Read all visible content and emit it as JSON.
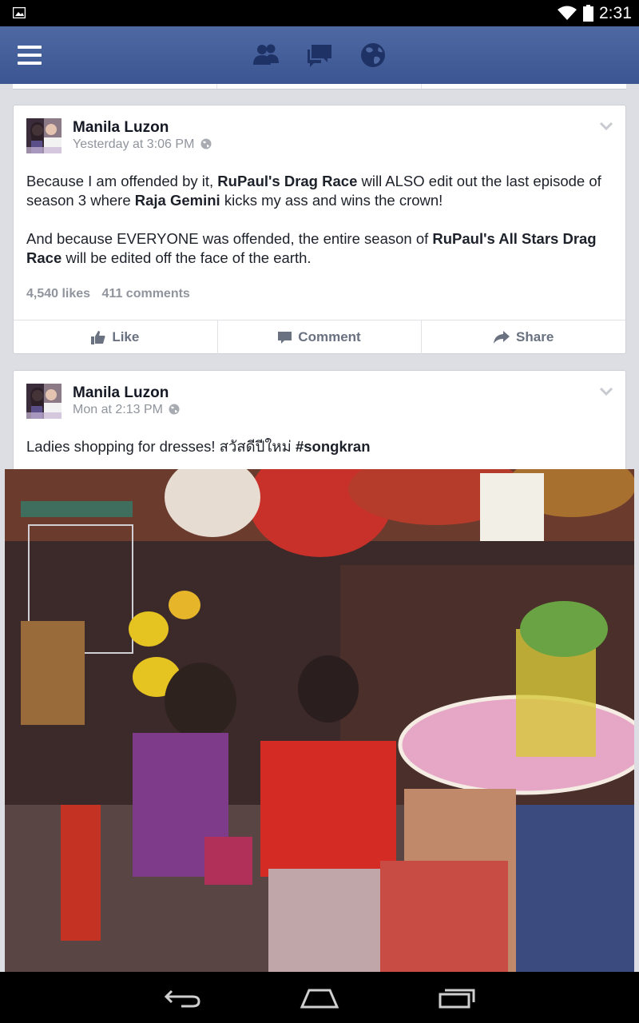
{
  "status_bar": {
    "time": "2:31"
  },
  "feed": {
    "posts": [
      {
        "author": "Manila Luzon",
        "timestamp": "Yesterday at 3:06 PM",
        "p1_pre": "Because I am offended by it, ",
        "p1_b1": "RuPaul's Drag Race",
        "p1_mid": " will ALSO edit out the last episode of season 3 where ",
        "p1_b2": "Raja Gemini",
        "p1_post": " kicks my ass and wins the crown!",
        "p2_pre": "And because EVERYONE was offended, the entire season of ",
        "p2_b1": "RuPaul's All Stars Drag Race",
        "p2_post": " will be edited off the face of the earth.",
        "likes": "4,540 likes",
        "comments": "411 comments",
        "actions": {
          "like": "Like",
          "comment": "Comment",
          "share": "Share"
        }
      },
      {
        "author": "Manila Luzon",
        "timestamp": "Mon at 2:13 PM",
        "text": "Ladies shopping for dresses! สวัสดีปีใหม่ ",
        "hashtag": "#songkran"
      }
    ]
  },
  "colors": {
    "fb_blue": "#3b5998",
    "text": "#141823",
    "meta": "#90949c"
  }
}
